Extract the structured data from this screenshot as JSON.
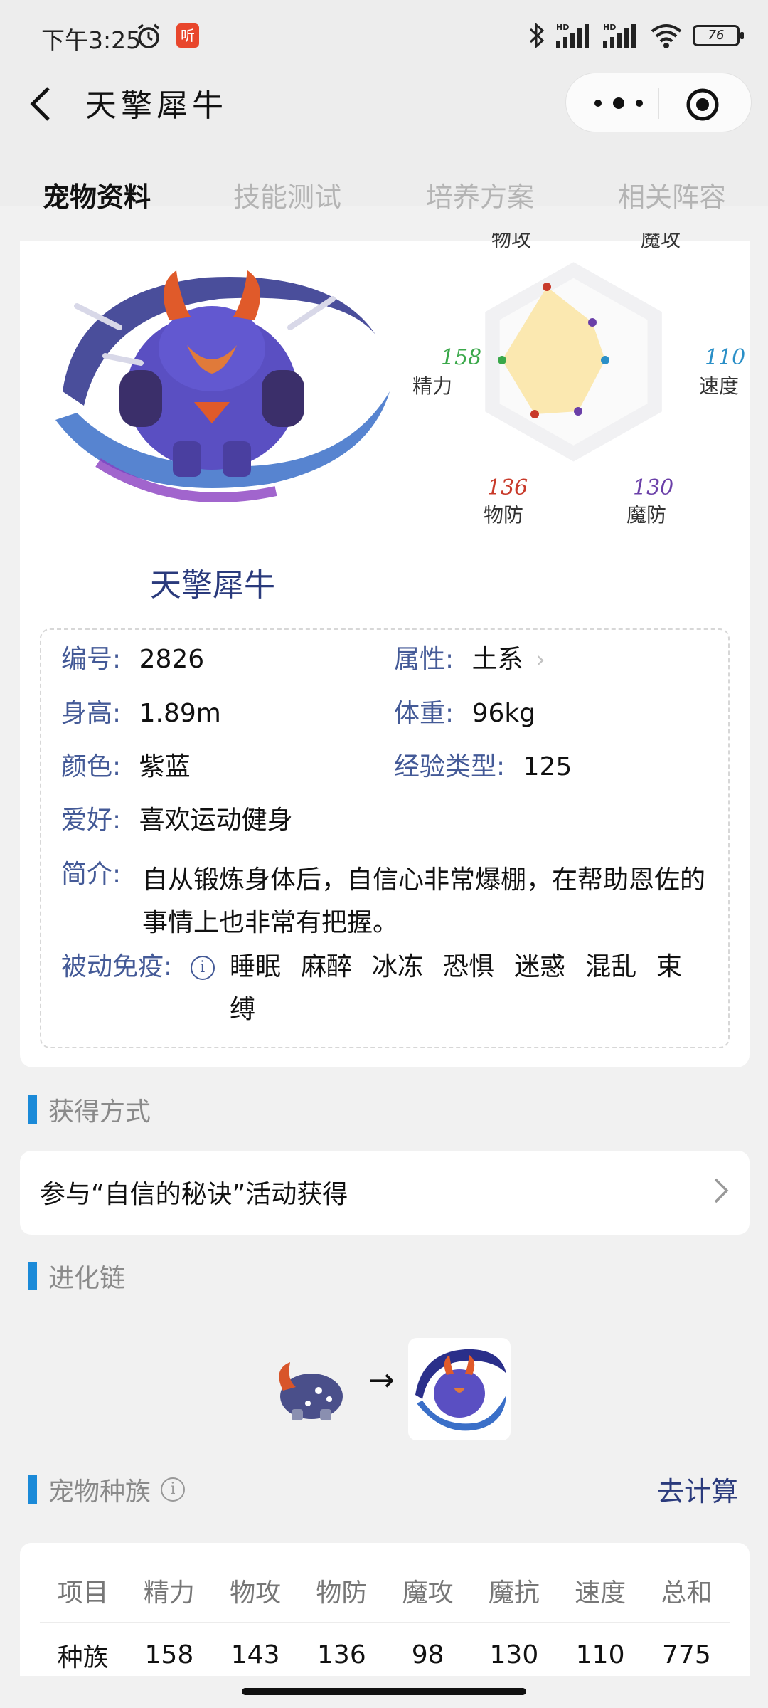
{
  "status_bar": {
    "time": "下午3:25",
    "listen_badge": "听",
    "battery": "76"
  },
  "header": {
    "title": "天擎犀牛"
  },
  "tabs": [
    {
      "label": "宠物资料",
      "active": true
    },
    {
      "label": "技能测试",
      "active": false
    },
    {
      "label": "培养方案",
      "active": false
    },
    {
      "label": "相关阵容",
      "active": false
    }
  ],
  "radar": {
    "labels": {
      "attack": "物攻",
      "magic_attack": "魔攻",
      "speed": "速度",
      "magic_defense": "魔防",
      "defense": "物防",
      "energy": "精力"
    },
    "values": {
      "energy": "158",
      "speed": "110",
      "defense": "136",
      "magic_defense": "130"
    },
    "colors": {
      "energy": "#3aa84a",
      "speed": "#2a8fc7",
      "defense": "#c83a2a",
      "magic_defense": "#6a3fa8",
      "fill": "#fbe8b0"
    }
  },
  "pet": {
    "name": "天擎犀牛",
    "number_label": "编号:",
    "number": "2826",
    "attribute_label": "属性:",
    "attribute": "土系",
    "height_label": "身高:",
    "height": "1.89m",
    "weight_label": "体重:",
    "weight": "96kg",
    "color_label": "颜色:",
    "color": "紫蓝",
    "exp_type_label": "经验类型:",
    "exp_type": "125",
    "hobby_label": "爱好:",
    "hobby": "喜欢运动健身",
    "intro_label": "简介:",
    "intro": "自从锻炼身体后，自信心非常爆棚，在帮助恩佐的事情上也非常有把握。",
    "immune_label": "被动免疫:",
    "immunities": [
      "睡眠",
      "麻醉",
      "冰冻",
      "恐惧",
      "迷惑",
      "混乱",
      "束缚"
    ]
  },
  "obtain": {
    "section_title": "获得方式",
    "text": "参与“自信的秘诀”活动获得"
  },
  "evolution": {
    "section_title": "进化链",
    "arrow": "→"
  },
  "race": {
    "section_title": "宠物种族",
    "calc_link": "去计算",
    "headers": [
      "项目",
      "精力",
      "物攻",
      "物防",
      "魔攻",
      "魔抗",
      "速度",
      "总和"
    ],
    "row": [
      "种族",
      "158",
      "143",
      "136",
      "98",
      "130",
      "110",
      "775"
    ]
  }
}
